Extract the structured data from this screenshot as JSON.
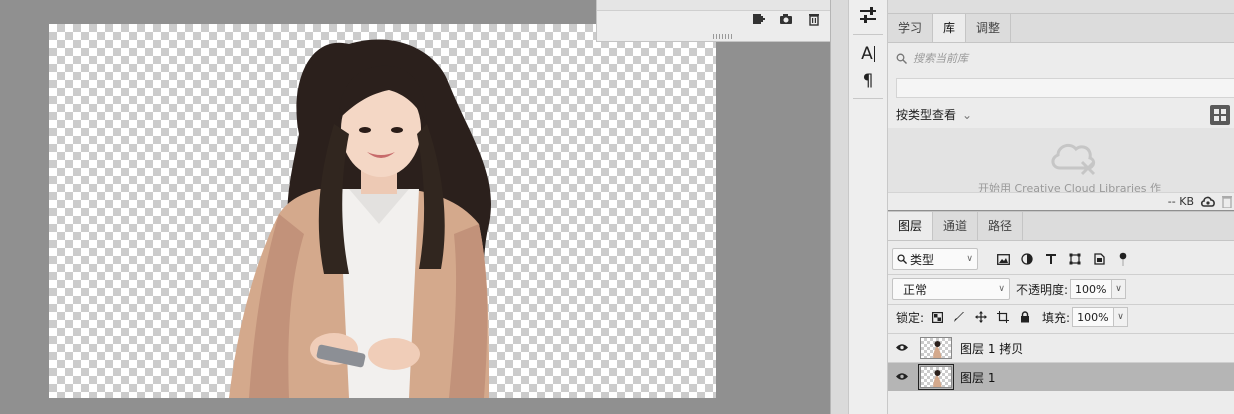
{
  "library_panel": {
    "tabs": [
      "学习",
      "库",
      "调整"
    ],
    "active_tab": "库",
    "search_placeholder": "搜索当前库",
    "view_label": "按类型查看",
    "empty_message": "开始用 Creative Cloud Libraries 作",
    "storage": "-- KB"
  },
  "layers_panel": {
    "tabs": [
      "图层",
      "通道",
      "路径"
    ],
    "active_tab": "图层",
    "filter_kind": "类型",
    "blend_mode": "正常",
    "opacity_label": "不透明度:",
    "opacity_value": "100%",
    "lock_label": "锁定:",
    "fill_label": "填充:",
    "fill_value": "100%",
    "layers": [
      {
        "name": "图层 1 拷贝",
        "visible": true,
        "selected": false
      },
      {
        "name": "图层 1",
        "visible": true,
        "selected": true
      }
    ]
  },
  "tools": [
    "adjust-sliders-icon",
    "character-icon",
    "paragraph-icon"
  ],
  "glyphs": {
    "char": "A",
    "para": "¶",
    "caret": "⌄",
    "down": "∨"
  }
}
